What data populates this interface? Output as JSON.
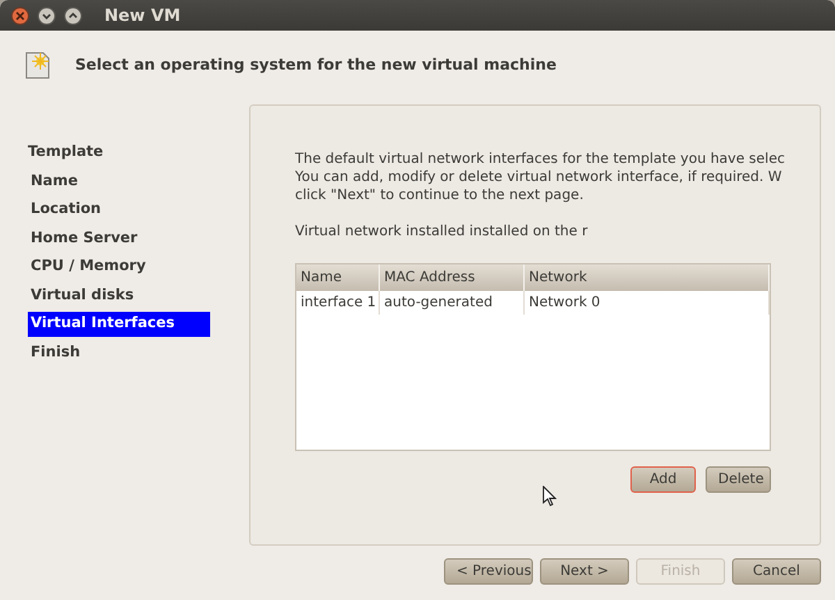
{
  "window": {
    "title": "New VM"
  },
  "header": {
    "title": "Select an operating system for the new virtual machine"
  },
  "sidebar": {
    "items": [
      {
        "label": "Template",
        "selected": false,
        "kind": "group"
      },
      {
        "label": "Name",
        "selected": false,
        "kind": "step"
      },
      {
        "label": "Location",
        "selected": false,
        "kind": "step"
      },
      {
        "label": "Home Server",
        "selected": false,
        "kind": "step"
      },
      {
        "label": "CPU / Memory",
        "selected": false,
        "kind": "step"
      },
      {
        "label": "Virtual disks",
        "selected": false,
        "kind": "step"
      },
      {
        "label": "Virtual Interfaces",
        "selected": true,
        "kind": "step"
      },
      {
        "label": "Finish",
        "selected": false,
        "kind": "step"
      }
    ]
  },
  "description": [
    "The default virtual network interfaces for the template you have selec",
    "You can add, modify or delete virtual network interface, if required. W",
    "click \"Next\" to continue to the next page."
  ],
  "note": "Virtual network installed installed on the r",
  "table": {
    "columns": [
      "Name",
      "MAC Address",
      "Network"
    ],
    "rows": [
      [
        "interface 1",
        "auto-generated",
        "Network 0"
      ]
    ]
  },
  "table_buttons": [
    {
      "label": "Add",
      "focused": true
    },
    {
      "label": "Delete",
      "focused": false
    }
  ],
  "footer_buttons": [
    {
      "label": "< Previous",
      "disabled": false
    },
    {
      "label": "Next >",
      "disabled": false
    },
    {
      "label": "Finish",
      "disabled": true
    },
    {
      "label": "Cancel",
      "disabled": false
    }
  ]
}
